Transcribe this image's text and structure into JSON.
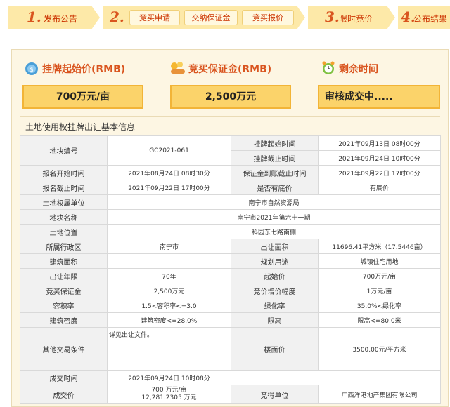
{
  "steps": [
    {
      "num": "1.",
      "label": "发布公告"
    },
    {
      "num": "2.",
      "subs": [
        "竞买申请",
        "交纳保证金",
        "竞买报价"
      ]
    },
    {
      "num": "3.",
      "label": "限时竞价"
    },
    {
      "num": "4.",
      "label": "公布结果"
    }
  ],
  "price_panel": {
    "start_price_title": "挂牌起始价(RMB)",
    "start_price_value": "700万元/亩",
    "deposit_title": "竞买保证金(RMB)",
    "deposit_value": "2,500万元",
    "time_title": "剩余时间",
    "time_value": "审核成交中....."
  },
  "section_title": "土地使用权挂牌出让基本信息",
  "info": {
    "plot_code_label": "地块编号",
    "plot_code": "GC2021-061",
    "listing_start_label": "挂牌起始时间",
    "listing_start": "2021年09月13日 08时00分",
    "listing_end_label": "挂牌截止时间",
    "listing_end": "2021年09月24日 10时00分",
    "reg_start_label": "报名开始时间",
    "reg_start": "2021年08月24日 08时30分",
    "deposit_deadline_label": "保证金到账截止时间",
    "deposit_deadline": "2021年09月22日 17时00分",
    "reg_end_label": "报名截止时间",
    "reg_end": "2021年09月22日 17时00分",
    "reserve_label": "是否有底价",
    "reserve": "有底价",
    "owner_label": "土地权属单位",
    "owner": "南宁市自然资源局",
    "plot_name_label": "地块名称",
    "plot_name": "南宁市2021年第六十一期",
    "location_label": "土地位置",
    "location": "科园东七路南侧",
    "district_label": "所属行政区",
    "district": "南宁市",
    "area_label": "出让面积",
    "area": "11696.41平方米（17.5446亩）",
    "building_area_label": "建筑面积",
    "building_area": "",
    "planned_use_label": "规划用途",
    "planned_use": "城镇住宅用地",
    "term_label": "出让年限",
    "term": "70年",
    "start_price_label": "起始价",
    "start_price": "700万元/亩",
    "deposit_label": "竞买保证金",
    "deposit": "2,500万元",
    "increment_label": "竞价增价幅度",
    "increment": "1万元/亩",
    "far_label": "容积率",
    "far": "1.5<容积率<=3.0",
    "green_label": "绿化率",
    "green": "35.0%<绿化率",
    "density_label": "建筑密度",
    "density": "建筑密度<=28.0%",
    "height_label": "限高",
    "height": "限高<=80.0米",
    "other_label": "其他交易条件",
    "other": "详见出让文件。",
    "floor_price_label": "楼面价",
    "floor_price": "3500.00元/平方米",
    "deal_time_label": "成交时间",
    "deal_time": "2021年09月24日 10时08分",
    "deal_price_label": "成交价",
    "deal_price_line1": "700 万元/亩",
    "deal_price_line2": "12,281.2305 万元",
    "winner_label": "竞得单位",
    "winner": "广西洋港地产集团有限公司"
  },
  "colors": {
    "accent": "#d9541e",
    "step_bg": "#fde9a8",
    "price_box": "#fbd36a",
    "panel_bg": "#fdf6e3"
  },
  "icons": [
    "money-bag-icon",
    "hand-coins-icon",
    "alarm-clock-icon"
  ]
}
